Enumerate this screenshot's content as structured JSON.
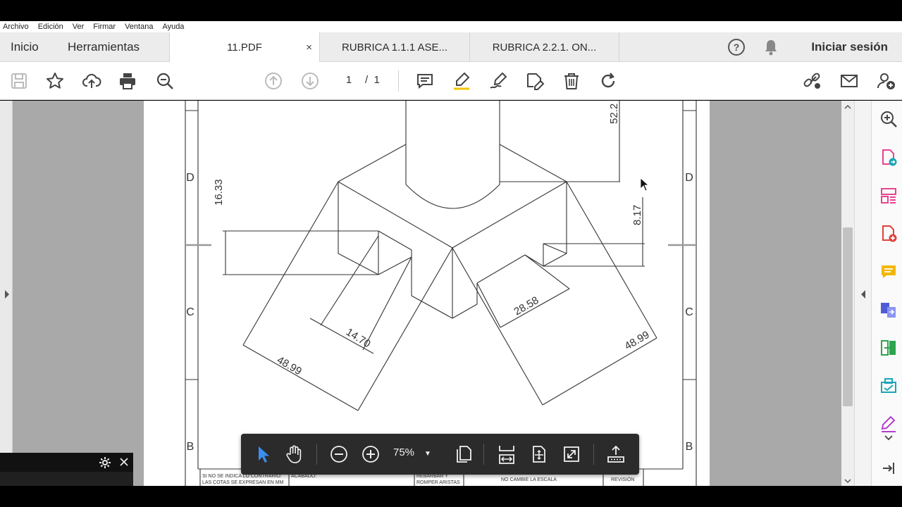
{
  "menu": [
    "Archivo",
    "Edición",
    "Ver",
    "Firmar",
    "Ventana",
    "Ayuda"
  ],
  "tabs": {
    "home": "Inicio",
    "tools": "Herramientas",
    "docs": [
      {
        "label": "11.PDF",
        "active": true,
        "close": "×"
      },
      {
        "label": "RUBRICA 1.1.1 ASE...",
        "active": false
      },
      {
        "label": "RUBRICA 2.2.1. ON...",
        "active": false
      }
    ],
    "sign_in": "Iniciar sesión"
  },
  "pager": {
    "current": "1",
    "separator": "/",
    "total": "1"
  },
  "zoom": {
    "level": "75%"
  },
  "drawing": {
    "zone_labels": [
      "D",
      "C",
      "B"
    ],
    "dimensions": [
      "52.2",
      "16.33",
      "8.17",
      "14.70",
      "28.58",
      "48.99",
      "48.99"
    ],
    "title_block": [
      "SI NO SE INDICA LO CONTRARIO:",
      "LAS COTAS SE EXPRESAN EN MM",
      "ACABADO:",
      "REBARBAR Y",
      "ROMPER ARISTAS",
      "NO CAMBIE LA ESCALA",
      "REVISIÓN"
    ]
  },
  "colors": {
    "accent": "#1473e6",
    "floatbar": "#2b2b2b"
  }
}
